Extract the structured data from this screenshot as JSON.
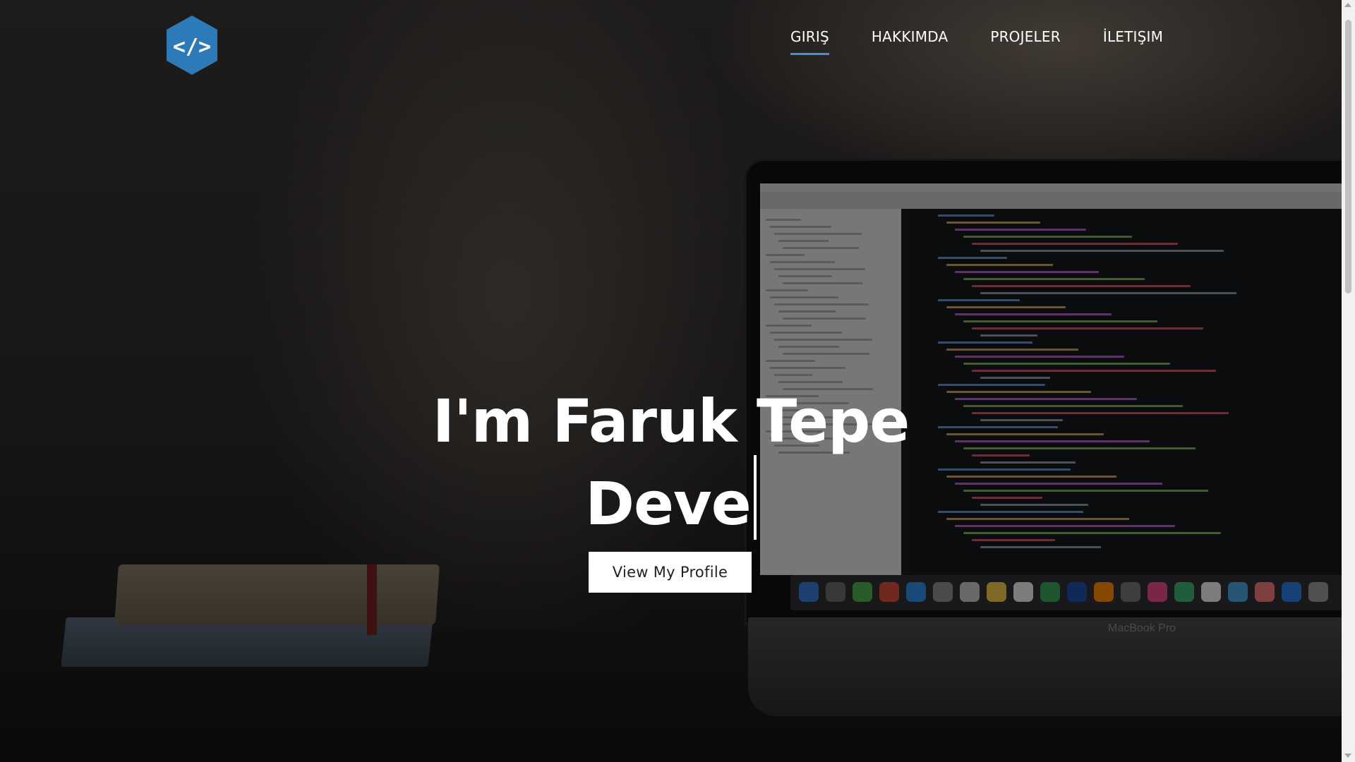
{
  "header": {
    "logo_icon": "code-brackets-icon",
    "logo_text": "</>",
    "brand_color": "#2d7ab8",
    "nav": [
      {
        "label": "GIRIŞ",
        "active": true
      },
      {
        "label": "HAKKIMDA",
        "active": false
      },
      {
        "label": "PROJELER",
        "active": false
      },
      {
        "label": "İLETIŞIM",
        "active": false
      }
    ],
    "active_underline_color": "#4a8fd6"
  },
  "hero": {
    "title": "I'm Faruk Tepe",
    "typed_text": "Deve",
    "button_label": "View My Profile"
  },
  "background": {
    "laptop_brand": "MacBook Pro"
  }
}
